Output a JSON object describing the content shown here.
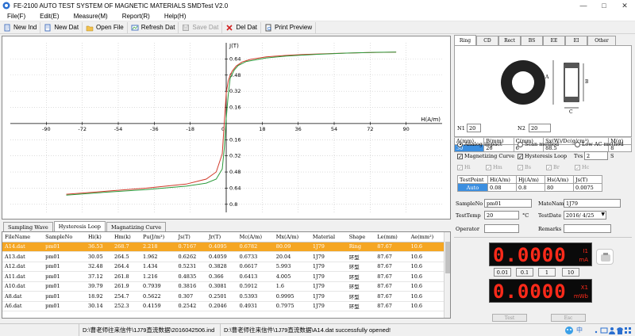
{
  "window": {
    "title": "FE-2100 AUTO TEST SYSTEM OF MAGNETIC MATERIALS   SMDTest V2.0",
    "minimize": "—",
    "maximize": "□",
    "close": "✕"
  },
  "menu": [
    "File(F)",
    "Edit(E)",
    "Measure(M)",
    "Report(R)",
    "Help(H)"
  ],
  "toolbar": {
    "new_ind": "New Ind",
    "new_dat": "New Dat",
    "open_file": "Open File",
    "refresh_dat": "Refresh Dat",
    "save_dat": "Save Dat",
    "del_dat": "Del Dat",
    "print_preview": "Print Preview"
  },
  "chart_data": {
    "type": "line",
    "xlabel": "H(A/m)",
    "ylabel": "J(T)",
    "xlim": [
      -108,
      108
    ],
    "ylim": [
      -0.88,
      0.8
    ],
    "x_ticks": [
      -90,
      -72,
      -54,
      -36,
      -18,
      18,
      36,
      54,
      72,
      90
    ],
    "x_tick_labels": [
      "-90",
      "-72",
      "-54",
      "-36",
      "-18",
      "18",
      "36",
      "54",
      "72",
      "90"
    ],
    "y_ticks": [
      0.64,
      0.48,
      0.32,
      0.16,
      -0.16,
      -0.32,
      -0.48,
      -0.64,
      -0.8
    ],
    "y_tick_labels": [
      "0.64",
      "0.48",
      "0.32",
      "0.16",
      "0.16",
      "0.32",
      "0.48",
      "0.64",
      "0.8"
    ],
    "zero_label": "0",
    "series": [
      {
        "color": "#d03a2a",
        "x": [
          -80,
          -60,
          -40,
          -20,
          -10,
          -5,
          -2,
          -1,
          0,
          1,
          2,
          3,
          5,
          8,
          12,
          20,
          30,
          40,
          55,
          70,
          85
        ],
        "y": [
          -0.7,
          -0.67,
          -0.64,
          -0.6,
          -0.55,
          -0.48,
          -0.3,
          0.0,
          0.3,
          0.42,
          0.48,
          0.52,
          0.57,
          0.61,
          0.635,
          0.66,
          0.675,
          0.685,
          0.695,
          0.703,
          0.708
        ]
      },
      {
        "color": "#2a9a3a",
        "x": [
          -80,
          -60,
          -40,
          -20,
          -10,
          -5,
          -2,
          -1,
          0,
          1,
          2,
          4,
          6,
          10,
          20,
          30,
          45,
          60,
          75,
          85
        ],
        "y": [
          -0.71,
          -0.68,
          -0.655,
          -0.62,
          -0.59,
          -0.55,
          -0.45,
          -0.25,
          0.05,
          0.28,
          0.45,
          0.53,
          0.575,
          0.615,
          0.65,
          0.668,
          0.685,
          0.698,
          0.706,
          0.708
        ]
      }
    ]
  },
  "bottom_tabs": [
    "Sampling Wave",
    "Hysteresis Loop",
    "Magnatizing Curve"
  ],
  "table": {
    "headers": [
      "FileName",
      "SampleNo",
      "Hi(k)",
      "Hm(k)",
      "Pu(J/m³)",
      "Js(T)",
      "Jr(T)",
      "Mc(A/m)",
      "Mx(A/m)",
      "Material",
      "Shape",
      "Le(mm)",
      "Ae(mm²)"
    ],
    "rows": [
      [
        "A14.dat",
        "pm01",
        "36.53",
        "268.7",
        "2.218",
        "0.7167",
        "0.4095",
        "0.6782",
        "80.09",
        "1J79",
        "Ring",
        "87.67",
        "10.6"
      ],
      [
        "A13.dat",
        "pm01",
        "30.05",
        "264.5",
        "1.962",
        "0.6262",
        "0.4059",
        "0.6733",
        "20.04",
        "1J79",
        "环型",
        "87.67",
        "10.6"
      ],
      [
        "A12.dat",
        "pm01",
        "32.48",
        "264.4",
        "1.434",
        "0.5231",
        "0.3828",
        "0.6617",
        "5.993",
        "1J79",
        "环型",
        "87.67",
        "10.6"
      ],
      [
        "A11.dat",
        "pm01",
        "37.12",
        "261.8",
        "1.216",
        "0.4835",
        "0.366",
        "0.6413",
        "4.005",
        "1J79",
        "环型",
        "87.67",
        "10.6"
      ],
      [
        "A10.dat",
        "pm01",
        "39.79",
        "261.9",
        "0.7939",
        "0.3816",
        "0.3081",
        "0.5912",
        "1.6",
        "1J79",
        "环型",
        "87.67",
        "10.6"
      ],
      [
        "A8.dat",
        "pm01",
        "18.92",
        "254.7",
        "0.5622",
        "0.307",
        "0.2501",
        "0.5393",
        "0.9995",
        "1J79",
        "环型",
        "87.67",
        "10.6"
      ],
      [
        "A6.dat",
        "pm01",
        "30.14",
        "252.3",
        "0.4159",
        "0.2542",
        "0.2046",
        "0.4931",
        "0.7975",
        "1J79",
        "环型",
        "87.67",
        "10.6"
      ]
    ]
  },
  "status": {
    "seg1": "",
    "seg2": "D:\\曹老师往来信件\\1J79直流数据\\2016042506.ind",
    "seg3": "D:\\曹老师往来信件\\1J79直流数据\\A14.dat successfully opened!"
  },
  "right": {
    "shape_tabs": [
      "Ring",
      "CD",
      "Rect",
      "BS",
      "EE",
      "EI",
      "Other"
    ],
    "dim_labels": {
      "a": "A",
      "b": "B",
      "c": "C"
    },
    "params": {
      "headers": [
        "A(mm)",
        "B(mm)",
        "C(mm)",
        "Sx(W)/Dc(g/cm³)",
        "M(g)"
      ],
      "values": [
        "30",
        "26",
        "6",
        "88.5",
        "8"
      ]
    },
    "n1_label": "N1",
    "n1_value": "20",
    "n2_label": "N2",
    "n2_value": "20",
    "methods": [
      "Analog impact",
      "Scan method",
      "Low AC method"
    ],
    "mag_curve": "Magnetizing Curve",
    "hyst_loop": "Hysteresis Loop",
    "tvs_label": "Tvs",
    "tvs_value": "2",
    "tvs_unit": "S",
    "param_checks": [
      "Hi",
      "Hm",
      "Bs",
      "Br",
      "Hc"
    ],
    "testpoint": {
      "headers": [
        "TestPoint",
        "Hi(A/m)",
        "Hj(A/m)",
        "Hs(A/m)",
        "Js(T)"
      ],
      "values": [
        "Auto",
        "0.08",
        "0.8",
        "80",
        "0.0075"
      ]
    },
    "sample_no_label": "SampleNo",
    "sample_no": "pm01",
    "mate_name_label": "MateName",
    "mate_name": "1J79",
    "test_temp_label": "TestTemp",
    "test_temp": "20",
    "temp_unit": "°C",
    "test_date_label": "TestDate",
    "test_date": "2016/ 4/25",
    "operator_label": "Operator",
    "operator": "",
    "remarks_label": "Remarks",
    "remarks": "",
    "display1": {
      "value": "0.0000",
      "unit_top": "I1",
      "unit_bottom": "mA"
    },
    "display2": {
      "value": "0.0000",
      "unit_top": "X1",
      "unit_bottom": "mWb"
    },
    "ranges": [
      "0.01",
      "0.1",
      "1",
      "10"
    ],
    "test_btn": "Test",
    "esc_btn": "Esc"
  },
  "colors": {
    "selected_row": "#f5a623",
    "selected_cell": "#3c8fe0",
    "led": "#ff2a1a"
  }
}
